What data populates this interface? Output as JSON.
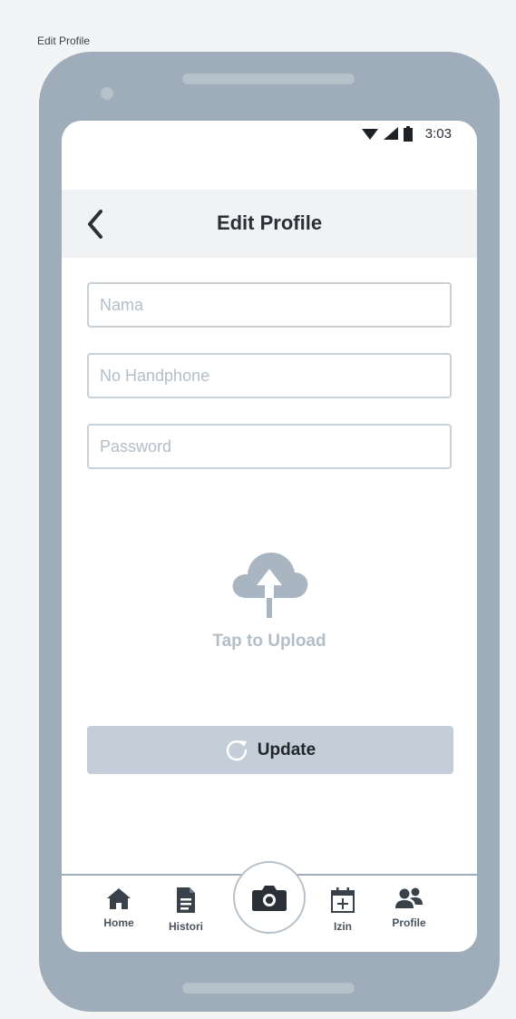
{
  "frame_label": "Edit Profile",
  "status_bar": {
    "time": "3:03"
  },
  "header": {
    "title": "Edit Profile"
  },
  "form": {
    "name_placeholder": "Nama",
    "phone_placeholder": "No Handphone",
    "password_placeholder": "Password"
  },
  "upload": {
    "label": "Tap to Upload"
  },
  "update_button": {
    "label": "Update"
  },
  "bottom_nav": {
    "items": [
      {
        "label": "Home",
        "icon": "home-icon"
      },
      {
        "label": "Histori",
        "icon": "document-icon"
      },
      {
        "label": "",
        "icon": "camera-icon"
      },
      {
        "label": "Izin",
        "icon": "calendar-add-icon"
      },
      {
        "label": "Profile",
        "icon": "users-icon"
      }
    ]
  },
  "colors": {
    "device": "#9eadb9",
    "header_bg": "#f0f2f4",
    "button_bg": "#c3ced8",
    "placeholder": "#b3bec7",
    "text_dark": "#2b3036"
  }
}
